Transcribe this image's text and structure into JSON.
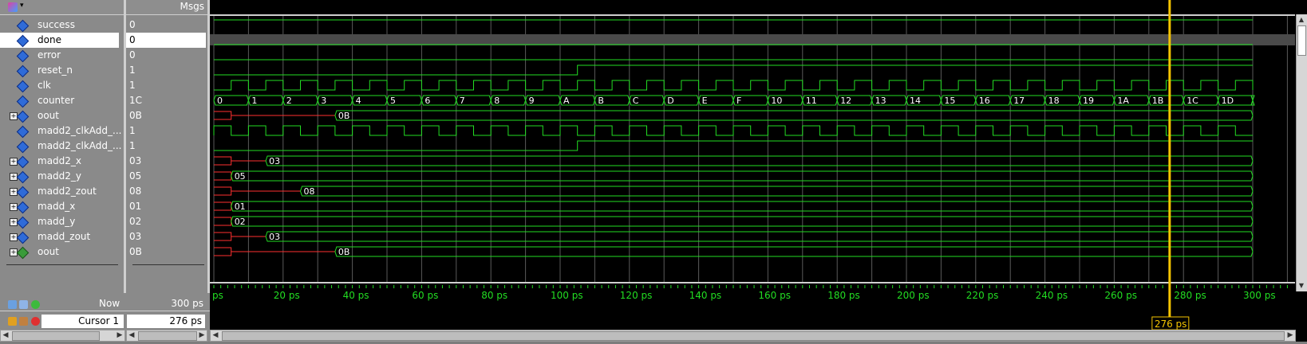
{
  "header": {
    "msgs_label": "Msgs"
  },
  "signals": [
    {
      "name": "success",
      "value": "0",
      "expandable": false,
      "icon": "signal-diamond-icon"
    },
    {
      "name": "done",
      "value": "0",
      "expandable": false,
      "icon": "signal-diamond-icon",
      "selected": true
    },
    {
      "name": "error",
      "value": "0",
      "expandable": false,
      "icon": "signal-diamond-icon"
    },
    {
      "name": "reset_n",
      "value": "1",
      "expandable": false,
      "icon": "signal-diamond-icon"
    },
    {
      "name": "clk",
      "value": "1",
      "expandable": false,
      "icon": "signal-diamond-icon"
    },
    {
      "name": "counter",
      "value": "1C",
      "expandable": false,
      "icon": "signal-diamond-icon"
    },
    {
      "name": "oout",
      "value": "0B",
      "expandable": true,
      "icon": "signal-diamond-icon"
    },
    {
      "name": "madd2_clkAdd_...",
      "value": "1",
      "expandable": false,
      "icon": "signal-diamond-icon"
    },
    {
      "name": "madd2_clkAdd_...",
      "value": "1",
      "expandable": false,
      "icon": "signal-diamond-icon"
    },
    {
      "name": "madd2_x",
      "value": "03",
      "expandable": true,
      "icon": "signal-diamond-icon"
    },
    {
      "name": "madd2_y",
      "value": "05",
      "expandable": true,
      "icon": "signal-diamond-icon"
    },
    {
      "name": "madd2_zout",
      "value": "08",
      "expandable": true,
      "icon": "signal-diamond-icon"
    },
    {
      "name": "madd_x",
      "value": "01",
      "expandable": true,
      "icon": "signal-diamond-icon"
    },
    {
      "name": "madd_y",
      "value": "02",
      "expandable": true,
      "icon": "signal-diamond-icon"
    },
    {
      "name": "madd_zout",
      "value": "03",
      "expandable": true,
      "icon": "signal-diamond-icon"
    },
    {
      "name": "oout",
      "value": "0B",
      "expandable": true,
      "icon": "signal-output-icon"
    }
  ],
  "waves": {
    "counter_labels": [
      "0",
      "1",
      "2",
      "3",
      "4",
      "5",
      "6",
      "7",
      "8",
      "9",
      "A",
      "B",
      "C",
      "D",
      "E",
      "F",
      "10",
      "11",
      "12",
      "13",
      "14",
      "15",
      "16",
      "17",
      "18",
      "19",
      "1A",
      "1B",
      "1C",
      "1D",
      ""
    ],
    "oout_label": "0B",
    "madd2_x_label": "03",
    "madd2_y_label": "05",
    "madd2_zout_label": "08",
    "madd_x_label": "01",
    "madd_y_label": "02",
    "madd_zout_label": "03",
    "oout2_label": "0B"
  },
  "timeline": {
    "ticks": [
      "ps",
      "20 ps",
      "40 ps",
      "60 ps",
      "80 ps",
      "100 ps",
      "120 ps",
      "140 ps",
      "160 ps",
      "180 ps",
      "200 ps",
      "220 ps",
      "240 ps",
      "260 ps",
      "280 ps",
      "300 ps"
    ],
    "now_label": "Now",
    "now_value": "300 ps",
    "cursor_label": "Cursor 1",
    "cursor_value": "276 ps",
    "cursor_time_ps": 276
  },
  "colors": {
    "wave": "#22dd22",
    "bus_unknown": "#ff3030",
    "cursor": "#f5c400",
    "grid": "#5a5a5a"
  }
}
